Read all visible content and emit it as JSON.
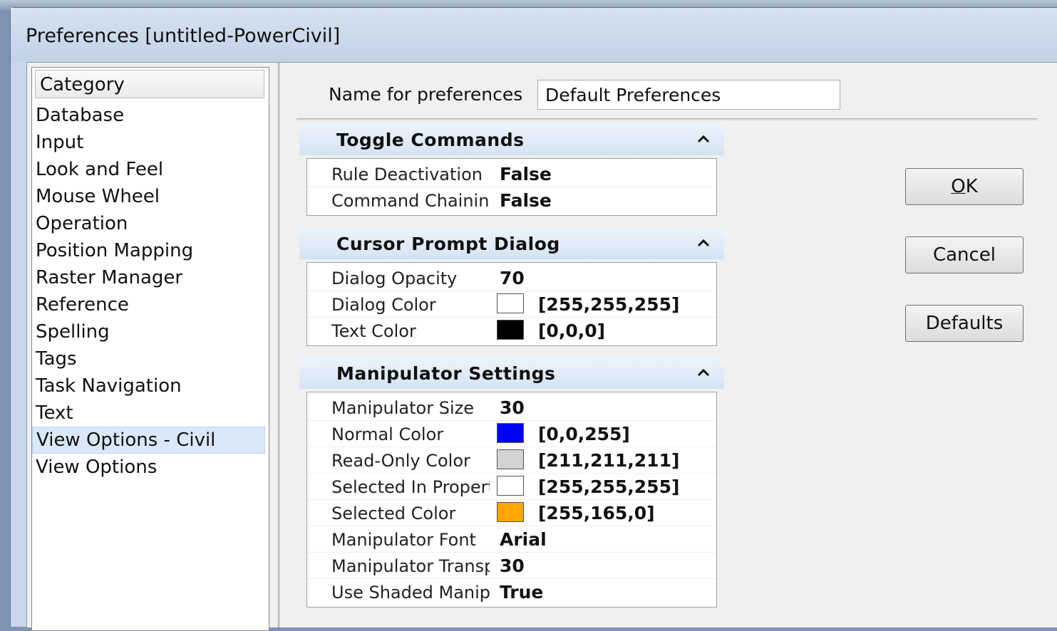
{
  "window": {
    "title": "Preferences [untitled-PowerCivil]"
  },
  "category": {
    "header": "Category",
    "items": [
      {
        "label": "Database"
      },
      {
        "label": "Input"
      },
      {
        "label": "Look and Feel"
      },
      {
        "label": "Mouse Wheel"
      },
      {
        "label": "Operation"
      },
      {
        "label": "Position Mapping"
      },
      {
        "label": "Raster Manager"
      },
      {
        "label": "Reference"
      },
      {
        "label": "Spelling"
      },
      {
        "label": "Tags"
      },
      {
        "label": "Task Navigation"
      },
      {
        "label": "Text"
      },
      {
        "label": "View Options - Civil",
        "selected": true
      },
      {
        "label": "View Options"
      }
    ]
  },
  "name_row": {
    "label": "Name for preferences",
    "value": "Default Preferences"
  },
  "sections": {
    "toggle": {
      "title": "Toggle Commands",
      "rows": [
        {
          "label": "Rule Deactivation",
          "value": "False"
        },
        {
          "label": "Command Chaining",
          "value": "False"
        }
      ]
    },
    "cursor": {
      "title": "Cursor Prompt Dialog",
      "rows": [
        {
          "label": "Dialog Opacity",
          "value": "70"
        },
        {
          "label": "Dialog Color",
          "value": "[255,255,255]",
          "color": "#ffffff"
        },
        {
          "label": "Text Color",
          "value": "[0,0,0]",
          "color": "#000000"
        }
      ]
    },
    "manipulator": {
      "title": "Manipulator Settings",
      "rows": [
        {
          "label": "Manipulator Size",
          "value": "30"
        },
        {
          "label": "Normal Color",
          "value": "[0,0,255]",
          "color": "#0000ff"
        },
        {
          "label": "Read-Only Color",
          "value": "[211,211,211]",
          "color": "#d3d3d3"
        },
        {
          "label": "Selected In Property",
          "value": "[255,255,255]",
          "color": "#ffffff"
        },
        {
          "label": "Selected Color",
          "value": "[255,165,0]",
          "color": "#ffa500"
        },
        {
          "label": "Manipulator Font",
          "value": "Arial"
        },
        {
          "label": "Manipulator Transparency",
          "value": "30"
        },
        {
          "label": "Use Shaded Manipulator",
          "value": "True"
        }
      ]
    }
  },
  "buttons": {
    "ok_mnemonic": "O",
    "ok_rest": "K",
    "cancel": "Cancel",
    "defaults": "Defaults"
  },
  "icons": {
    "collapse": "chevron-up-icon"
  }
}
